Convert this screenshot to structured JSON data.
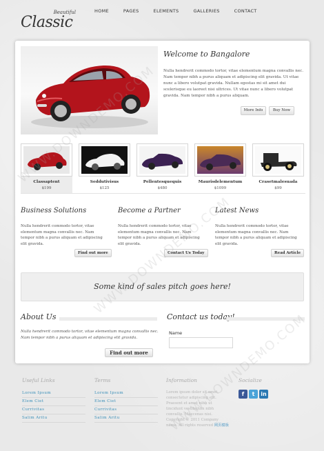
{
  "brand": {
    "small": "Beautiful",
    "big": "Classic"
  },
  "nav": [
    "HOME",
    "PAGES",
    "ELEMENTS",
    "GALLERIES",
    "CONTACT"
  ],
  "hero": {
    "title": "Welcome to Bangalore",
    "text": "Nulla hendrerit commodo tortor, vitae elementum magna convallis nec. Nam tempor nibh a purus aliquam et adipiscing elit gravida. Ut vitae nunc a libero volutpat gravida. Nullam egestas mi sit amet dui scelerisque eu laoreet nisi ultrices. Ut vitae nunc a libero volutpat gravida. Nam tempor nibh a purus aliquam.",
    "more_info": "More Info",
    "buy_now": "Buy Now"
  },
  "thumbs": [
    {
      "name": "Classaptent",
      "price": "$199"
    },
    {
      "name": "Seddutivisus",
      "price": "$125"
    },
    {
      "name": "Pellentesquequis",
      "price": "$480"
    },
    {
      "name": "Maurisdelementum",
      "price": "$1099"
    },
    {
      "name": "Crasetmalesuada",
      "price": "$99"
    }
  ],
  "columns": [
    {
      "title": "Business Solutions",
      "text": "Nulla hendrerit commodo tortor, vitae elementum magna convallis nec. Nam tempor nibh a purus aliquam et adipiscing elit gravida.",
      "button": "Find out more"
    },
    {
      "title": "Become a Partner",
      "text": "Nulla hendrerit commodo tortor, vitae elementum magna convallis nec. Nam tempor nibh a purus aliquam et adipiscing elit gravida.",
      "button": "Contact Us Today"
    },
    {
      "title": "Latest News",
      "text": "Nulla hendrerit commodo tortor, vitae elementum magna convallis nec. Nam tempor nibh a purus aliquam et adipiscing elit gravida.",
      "button": "Read Article"
    }
  ],
  "pitch": "Some kind of sales pitch goes here!",
  "about": {
    "title": "About Us",
    "text": "Nulla hendrerit commodo tortor, vitae elementum magna convallis nec. Nam tempor nibh a purus aliquam et adipiscing elit gravida.",
    "button": "Find out more"
  },
  "contact": {
    "title": "Contact us today!",
    "name_label": "Name",
    "name_value": ""
  },
  "footer": {
    "useful_links": {
      "title": "Useful Links",
      "links": [
        "Lorem Ipsum",
        "Elem Ciet",
        "Currivitas",
        "Salim Aritu"
      ]
    },
    "terms": {
      "title": "Terms",
      "links": [
        "Lorem Ipsum",
        "Elem Ciet",
        "Currivitas",
        "Salim Aritu"
      ]
    },
    "information": {
      "title": "Information",
      "text": "Lorem ipsum dolor sit amet, consectetur adipiscing elit. Praesent et amet nibh ut tincidunt vestibulum nibh convallis. Maecenas nisi.",
      "copyright": "Copyright © 2011 Company name.",
      "rights": "All rights reserved",
      "rights_link": "网页模板"
    },
    "social": {
      "title": "Socialize",
      "icons": [
        "f",
        "t",
        "in"
      ]
    }
  },
  "watermark": "WWW.DOWNDEMO.COM",
  "colors": {
    "link": "#3a8fb8",
    "facebook": "#3b5998",
    "twitter": "#4aa3d8",
    "linkedin": "#2a78b2"
  }
}
